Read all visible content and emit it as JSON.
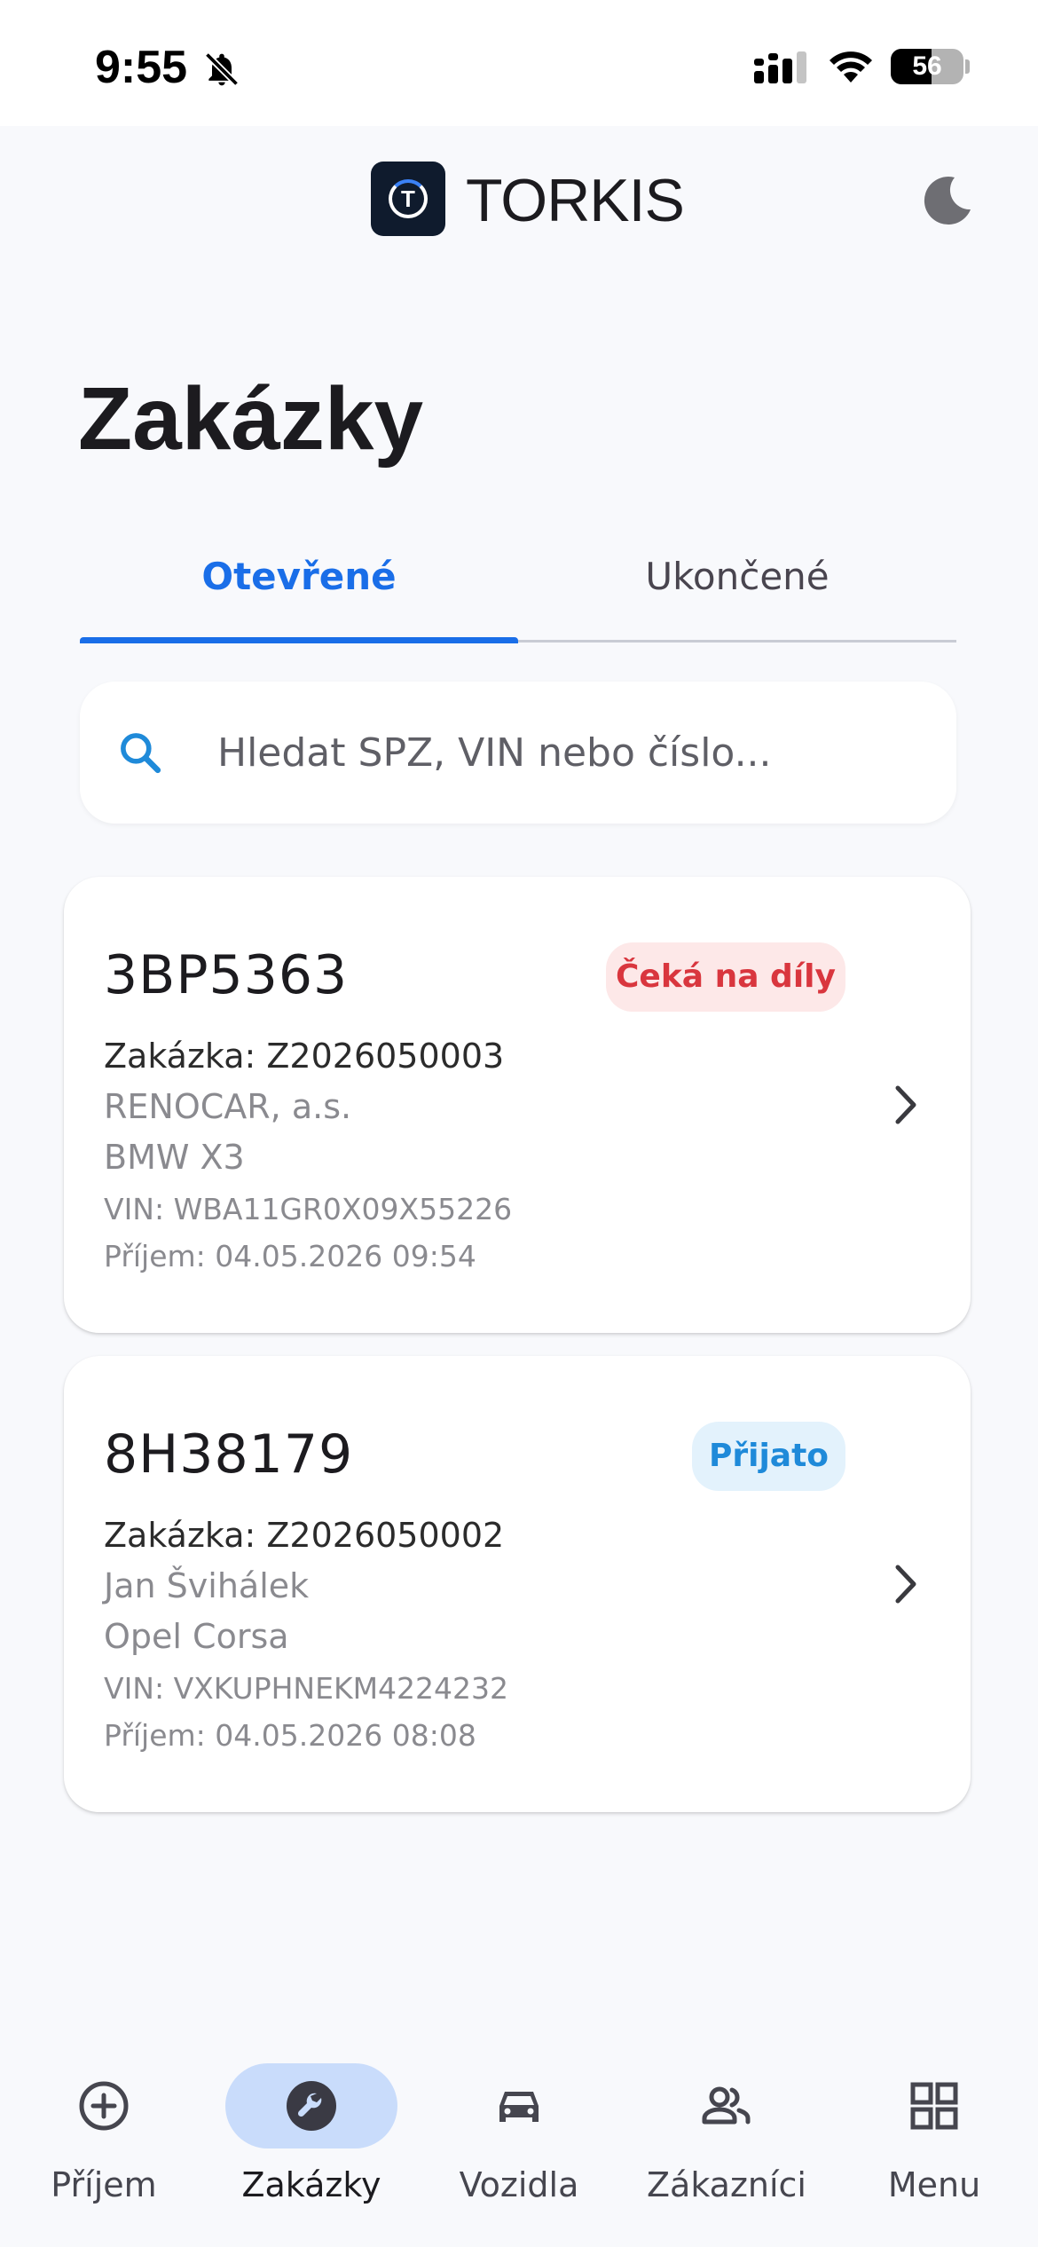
{
  "status_bar": {
    "time": "9:55",
    "battery_level": "56",
    "battery_fraction": 0.56
  },
  "header": {
    "logo_letter": "T",
    "brand": "TORKIS",
    "theme_icon": "moon-icon"
  },
  "page": {
    "title": "Zakázky"
  },
  "tabs": [
    {
      "label": "Otevřené",
      "active": true
    },
    {
      "label": "Ukončené",
      "active": false
    }
  ],
  "search": {
    "placeholder": "Hledat SPZ, VIN nebo číslo...",
    "value": "",
    "icon": "search-icon"
  },
  "orders": [
    {
      "plate": "3BP5363",
      "status": "Čeká na díly",
      "status_color": "#d9363e",
      "order_line": "Zakázka: Z2026050003",
      "customer": "RENOCAR, a.s.",
      "vehicle": "BMW X3",
      "vin_line": "VIN: WBA11GR0X09X55226",
      "received_line": "Příjem: 04.05.2026 09:54"
    },
    {
      "plate": "8H38179",
      "status": "Přijato",
      "status_color": "#1f8ad9",
      "order_line": "Zakázka: Z2026050002",
      "customer": "Jan Švihálek",
      "vehicle": "Opel Corsa",
      "vin_line": "VIN: VXKUPHNEKM4224232",
      "received_line": "Příjem: 04.05.2026 08:08"
    }
  ],
  "bottom_nav": [
    {
      "label": "Příjem",
      "icon": "add-circle-icon",
      "active": false
    },
    {
      "label": "Zakázky",
      "icon": "wrench-icon",
      "active": true
    },
    {
      "label": "Vozidla",
      "icon": "car-icon",
      "active": false
    },
    {
      "label": "Zákazníci",
      "icon": "people-icon",
      "active": false
    },
    {
      "label": "Menu",
      "icon": "grid-icon",
      "active": false
    }
  ],
  "colors": {
    "accent": "#1a6ee8",
    "background": "#f8f9fc",
    "active_nav_pill": "#c9dcfb"
  }
}
